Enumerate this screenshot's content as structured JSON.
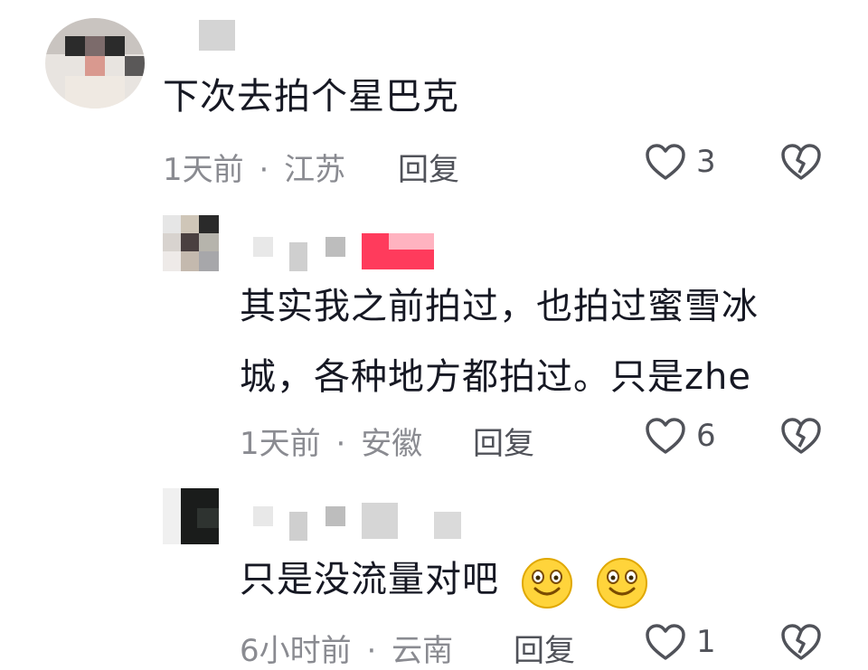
{
  "comments": [
    {
      "text_lines": [
        "下次去拍个星巴克"
      ],
      "time": "1天前",
      "location": "江苏",
      "reply_label": "回复",
      "likes": "3"
    },
    {
      "text_lines": [
        "其实我之前拍过，也拍过蜜雪冰",
        "城，各种地方都拍过。只是zhe"
      ],
      "time": "1天前",
      "location": "安徽",
      "reply_label": "回复",
      "likes": "6"
    },
    {
      "text_lines": [
        "只是没流量对吧"
      ],
      "time": "6小时前",
      "location": "云南",
      "reply_label": "回复",
      "likes": "1",
      "emojis": [
        "smile-emoji",
        "smile-emoji"
      ]
    }
  ],
  "meta_separator": "·",
  "colors": {
    "text": "#161823",
    "meta": "#8a8b91",
    "icon": "#505259",
    "name_pink": "#ff3b5c"
  },
  "icons": {
    "like": "heart-outline-icon",
    "dislike": "broken-heart-icon"
  }
}
